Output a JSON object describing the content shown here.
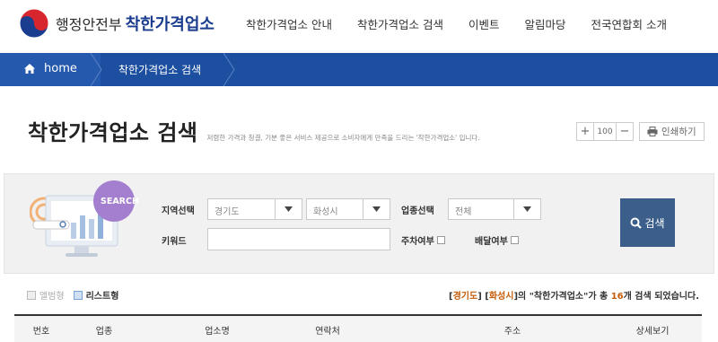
{
  "header": {
    "logo_ministry": "행정안전부",
    "logo_brand": "착한가격업소",
    "nav": [
      "착한가격업소 안내",
      "착한가격업소 검색",
      "이벤트",
      "알림마당",
      "전국연합회 소개"
    ]
  },
  "breadcrumb": {
    "home": "home",
    "current": "착한가격업소 검색"
  },
  "page": {
    "title": "착한가격업소 검색",
    "desc": "저렴한 가격과 청결, 기분 좋은 서비스 제공으로 소비자에게 만족을 드리는 '착한가격업소' 입니다.",
    "zoom": "100",
    "print_label": "인쇄하기"
  },
  "search": {
    "region_label": "지역선택",
    "region_province": "경기도",
    "region_city": "화성시",
    "category_label": "업종선택",
    "category_value": "전체",
    "keyword_label": "키워드",
    "keyword_value": "",
    "parking_label": "주차여부",
    "delivery_label": "배달여부",
    "button_label": "검색",
    "illustration_text": "SEARCH"
  },
  "view": {
    "album": "앨범형",
    "list": "리스트형"
  },
  "result": {
    "province": "경기도",
    "city": "화성시",
    "keyword": "착한가격업소",
    "count": "16",
    "p1": "[",
    "p2": "] [",
    "p3": "]의 \"",
    "p4": "\"가 총 ",
    "p5": "개 검색 되었습니다."
  },
  "table": {
    "headers": [
      "번호",
      "업종",
      "업소명",
      "연락처",
      "주소",
      "상세보기"
    ]
  },
  "colors": {
    "nav_bar": "#1c4fa0",
    "search_button": "#3b5f8a",
    "highlight": "#c45c0a"
  }
}
